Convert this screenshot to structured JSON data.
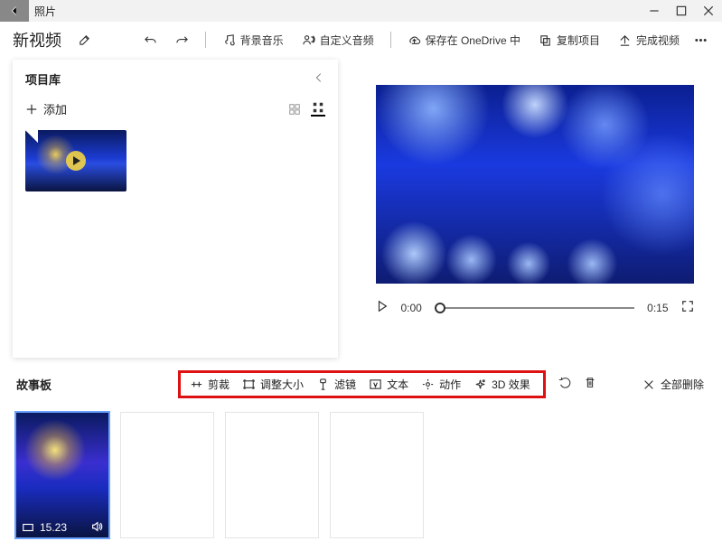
{
  "titlebar": {
    "app_name": "照片"
  },
  "project": {
    "title": "新视频"
  },
  "toolbar": {
    "bg_music": "背景音乐",
    "custom_audio": "自定义音频",
    "save_onedrive": "保存在 OneDrive 中",
    "copy_project": "复制项目",
    "finish_video": "完成视频"
  },
  "library": {
    "title": "项目库",
    "add_label": "添加"
  },
  "player": {
    "current_time": "0:00",
    "total_time": "0:15"
  },
  "storyboard": {
    "title": "故事板",
    "tools": {
      "trim": "剪裁",
      "resize": "调整大小",
      "filter": "滤镜",
      "text": "文本",
      "motion": "动作",
      "fx3d": "3D 效果"
    },
    "delete_all": "全部删除",
    "clip_duration": "15.23"
  }
}
